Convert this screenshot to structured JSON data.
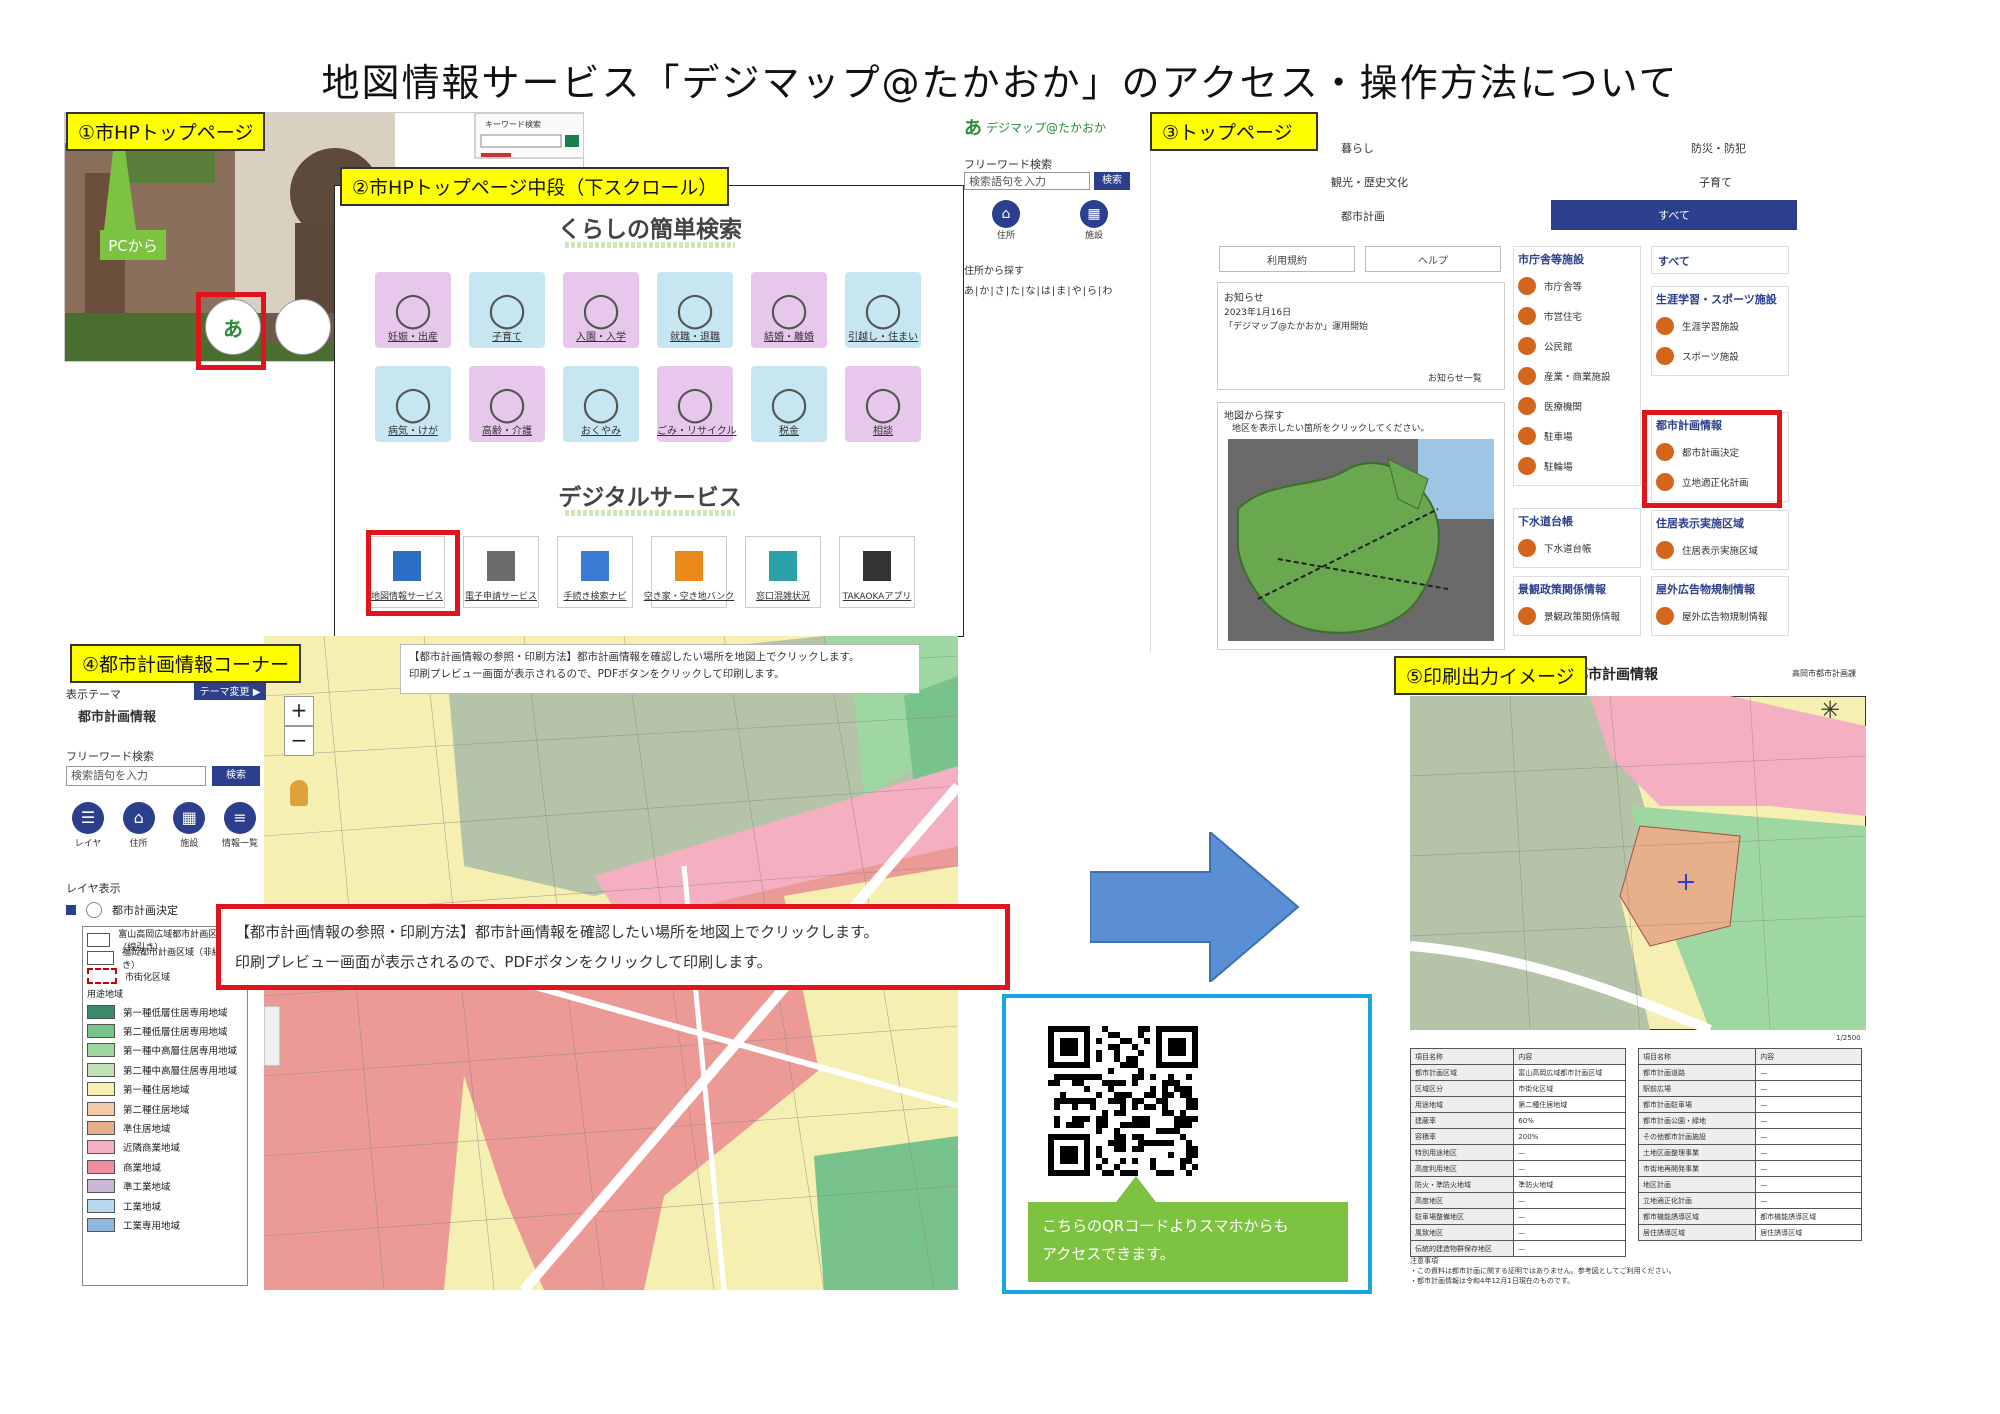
{
  "page": {
    "title": "地図情報サービス「デジマップ@たかおか」のアクセス・操作方法について"
  },
  "labels": {
    "step1": "①市HPトップページ",
    "step2": "②市HPトップページ中段（下スクロール）",
    "step3": "③トップページ",
    "step4": "④都市計画情報コーナー",
    "step5": "⑤印刷出力イメージ"
  },
  "step1": {
    "pc_callout": "PCから",
    "search_box_label": "キーワード検索"
  },
  "step2": {
    "heading_life": "くらしの簡単検索",
    "life_tiles": [
      {
        "label": "妊娠・出産",
        "color": "#e7c8ec"
      },
      {
        "label": "子育て",
        "color": "#c6e6f2"
      },
      {
        "label": "入園・入学",
        "color": "#e7c8ec"
      },
      {
        "label": "就職・退職",
        "color": "#c6e6f2"
      },
      {
        "label": "結婚・離婚",
        "color": "#e7c8ec"
      },
      {
        "label": "引越し・住まい",
        "color": "#c6e6f2"
      },
      {
        "label": "病気・けが",
        "color": "#c6e6f2"
      },
      {
        "label": "高齢・介護",
        "color": "#e7c8ec"
      },
      {
        "label": "おくやみ",
        "color": "#c6e6f2"
      },
      {
        "label": "ごみ・リサイクル",
        "color": "#e7c8ec"
      },
      {
        "label": "税金",
        "color": "#c6e6f2"
      },
      {
        "label": "相談",
        "color": "#e7c8ec"
      }
    ],
    "heading_digital": "デジタルサービス",
    "digital_tiles": [
      {
        "label": "地図情報サービス"
      },
      {
        "label": "電子申請サービス"
      },
      {
        "label": "手続き検索ナビ"
      },
      {
        "label": "空き家・空き地バンク"
      },
      {
        "label": "窓口混雑状況"
      },
      {
        "label": "TAKAOKAアプリ"
      }
    ]
  },
  "step3_left": {
    "logo_text": "デジマップ@たかおか",
    "freeword_label": "フリーワード検索",
    "search_placeholder": "検索語句を入力",
    "search_button": "検索",
    "icon_address": "住所",
    "icon_facility": "施設",
    "address_label": "住所から探す",
    "kana_row": "あ|か|さ|た|な|は|ま|や|ら|わ"
  },
  "step3": {
    "tabs_row1": [
      "暮らし",
      "防災・防犯"
    ],
    "tabs_row2": [
      "観光・歴史文化",
      "子育て"
    ],
    "tabs_row3": [
      "都市計画",
      "すべて"
    ],
    "btn_usage": "利用規約",
    "btn_help": "ヘルプ",
    "notice_title": "お知らせ",
    "notice_date": "2023年1月16日",
    "notice_text": "「デジマップ@たかおか」運用開始",
    "notice_more": "お知らせ一覧",
    "map_title": "地図から探す",
    "map_hint": "地区を表示したい箇所をクリックしてください。",
    "col1_title": "市庁舎等施設",
    "col1_items": [
      "市庁舎等",
      "市営住宅",
      "公民館",
      "産業・商業施設",
      "医療機関",
      "駐車場",
      "駐輪場"
    ],
    "col1b_title": "下水道台帳",
    "col1b_items": [
      "下水道台帳"
    ],
    "col1c_title": "景観政策関係情報",
    "col1c_items": [
      "景観政策関係情報"
    ],
    "col2_all": "すべて",
    "col2_sports_title": "生涯学習・スポーツ施設",
    "col2_sports_items": [
      "生涯学習施設",
      "スポーツ施設"
    ],
    "col2_city_title": "都市計画情報",
    "col2_city_items": [
      "都市計画決定",
      "立地適正化計画"
    ],
    "col2_addr_title": "住居表示実施区域",
    "col2_addr_items": [
      "住居表示実施区域"
    ],
    "col2_ad_title": "屋外広告物規制情報",
    "col2_ad_items": [
      "屋外広告物規制情報"
    ]
  },
  "step4": {
    "theme_label": "表示テーマ",
    "theme_button": "テーマ変更 ▶",
    "theme_value": "都市計画情報",
    "freeword_label": "フリーワード検索",
    "search_placeholder": "検索語句を入力",
    "search_button": "検索",
    "icons": [
      "レイヤ",
      "住所",
      "施設",
      "情報一覧"
    ],
    "layer_label": "レイヤ表示",
    "layer_item": "都市計画決定",
    "legend_top": [
      "富山高岡広域都市計画区域（線引き）",
      "福岡都市計画区域（非線引き）",
      "市街化区域"
    ],
    "legend_group": "用途地域",
    "legend_items": [
      {
        "label": "第一種低層住居専用地域",
        "color": "#3d8a6a"
      },
      {
        "label": "第二種低層住居専用地域",
        "color": "#78c28c"
      },
      {
        "label": "第一種中高層住居専用地域",
        "color": "#9fd7a2"
      },
      {
        "label": "第二種中高層住居専用地域",
        "color": "#bfe3b5"
      },
      {
        "label": "第一種住居地域",
        "color": "#f6efb2"
      },
      {
        "label": "第二種住居地域",
        "color": "#f3c9a7"
      },
      {
        "label": "準住居地域",
        "color": "#e8b08a"
      },
      {
        "label": "近隣商業地域",
        "color": "#f4b0c0"
      },
      {
        "label": "商業地域",
        "color": "#ee8f9f"
      },
      {
        "label": "準工業地域",
        "color": "#c9b8d8"
      },
      {
        "label": "工業地域",
        "color": "#b9d8ec"
      },
      {
        "label": "工業専用地域",
        "color": "#8fb8dc"
      }
    ],
    "map_tooltip_line1": "【都市計画情報の参照・印刷方法】都市計画情報を確認したい場所を地図上でクリックします。",
    "map_tooltip_line2": "印刷プレビュー画面が表示されるので、PDFボタンをクリックして印刷します。",
    "highlight_line1": "【都市計画情報の参照・印刷方法】都市計画情報を確認したい場所を地図上でクリックします。",
    "highlight_line2": "印刷プレビュー画面が表示されるので、PDFボタンをクリックして印刷します。"
  },
  "qr": {
    "caption_line1": "こちらのQRコードよりスマホからも",
    "caption_line2": "アクセスできます。",
    "border_color": "#1aa6df",
    "caption_bg": "#7dc241"
  },
  "step5": {
    "doc_title": "都市計画情報",
    "doc_subtitle": "高岡市都市計画課",
    "table_left": [
      [
        "項目名称",
        "内容"
      ],
      [
        "都市計画区域",
        "富山高岡広域都市計画区域"
      ],
      [
        "区域区分",
        "市街化区域"
      ],
      [
        "用途地域",
        "第二種住居地域"
      ],
      [
        "建蔽率",
        "60%"
      ],
      [
        "容積率",
        "200%"
      ],
      [
        "特別用途地区",
        "—"
      ],
      [
        "高度利用地区",
        "—"
      ],
      [
        "防火・準防火地域",
        "準防火地域"
      ],
      [
        "高度地区",
        "—"
      ],
      [
        "駐車場整備地区",
        "—"
      ],
      [
        "風致地区",
        "—"
      ],
      [
        "伝統的建造物群保存地区",
        "—"
      ]
    ],
    "table_right": [
      [
        "項目名称",
        "内容"
      ],
      [
        "都市計画道路",
        "—"
      ],
      [
        "駅前広場",
        "—"
      ],
      [
        "都市計画駐車場",
        "—"
      ],
      [
        "都市計画公園・緑地",
        "—"
      ],
      [
        "その他都市計画施設",
        "—"
      ],
      [
        "土地区画整理事業",
        "—"
      ],
      [
        "市街地再開発事業",
        "—"
      ],
      [
        "地区計画",
        "—"
      ],
      [
        "立地適正化計画",
        "—"
      ],
      [
        "都市機能誘導区域",
        "都市機能誘導区域"
      ],
      [
        "居住誘導区域",
        "居住誘導区域"
      ]
    ],
    "scale": "1/2500",
    "note_title": "注意事項",
    "note_line1": "・この資料は都市計画に関する証明ではありません。参考図としてご利用ください。",
    "note_line2": "・都市計画情報は令和4年12月1日現在のものです。"
  },
  "colors": {
    "label_yellow": "#ffff00",
    "highlight_red": "#e0141c",
    "arrow_blue": "#5b8fd4",
    "theme_navy": "#2b3f8c"
  }
}
